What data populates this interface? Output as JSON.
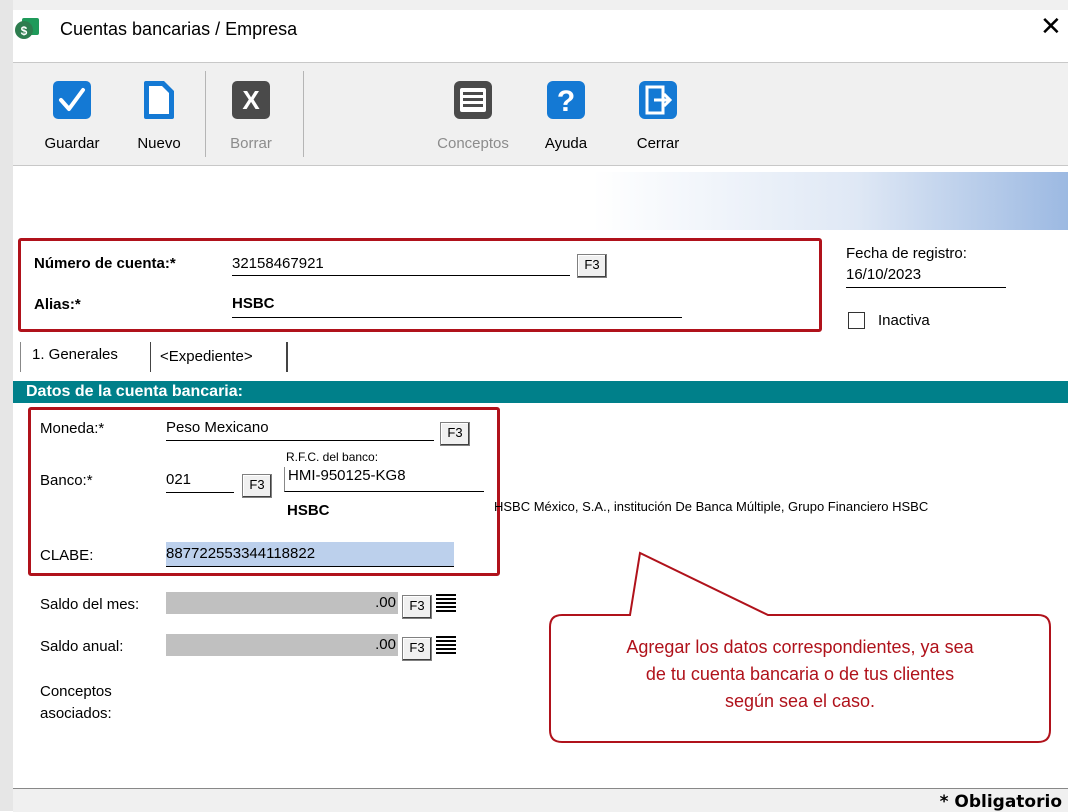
{
  "window": {
    "title": "Cuentas bancarias / Empresa",
    "close_glyph": "✕",
    "app_icon": "app-money-icon"
  },
  "toolbar": {
    "buttons": [
      {
        "id": "guardar",
        "label": "Guardar",
        "icon": "check-icon",
        "enabled": true
      },
      {
        "id": "nuevo",
        "label": "Nuevo",
        "icon": "new-document-icon",
        "enabled": true
      },
      {
        "id": "borrar",
        "label": "Borrar",
        "icon": "delete-x-icon",
        "enabled": false
      },
      {
        "id": "conceptos",
        "label": "Conceptos",
        "icon": "list-icon",
        "enabled": false
      },
      {
        "id": "ayuda",
        "label": "Ayuda",
        "icon": "help-icon",
        "enabled": true
      },
      {
        "id": "cerrar",
        "label": "Cerrar",
        "icon": "exit-door-icon",
        "enabled": true
      }
    ]
  },
  "header": {
    "numero_cuenta_label": "Número de cuenta:*",
    "numero_cuenta_value": "32158467921",
    "alias_label": "Alias:*",
    "alias_value": "HSBC",
    "f3": "F3",
    "fecha_label": "Fecha de registro:",
    "fecha_value": "16/10/2023",
    "inactiva_label": "Inactiva",
    "inactiva_checked": false
  },
  "tabs": [
    {
      "label": "1. Generales",
      "active": true
    },
    {
      "label": "<Expediente>",
      "active": false
    }
  ],
  "section": {
    "title": "Datos de la cuenta bancaria:"
  },
  "form": {
    "moneda_label": "Moneda:*",
    "moneda_value": "Peso Mexicano",
    "banco_label": "Banco:*",
    "banco_value": "021",
    "rfc_label": "R.F.C. del banco:",
    "rfc_value": "HMI-950125-KG8",
    "banco_nombre": "HSBC",
    "banco_razon_social": "HSBC México, S.A., institución De Banca Múltiple, Grupo Financiero HSBC",
    "clabe_label": "CLABE:",
    "clabe_value": "887722553344118822",
    "saldo_mes_label": "Saldo del mes:",
    "saldo_mes_value": ".00",
    "saldo_anual_label": "Saldo anual:",
    "saldo_anual_value": ".00",
    "conceptos_label_1": "Conceptos",
    "conceptos_label_2": "asociados:",
    "f3": "F3"
  },
  "callout": {
    "line1": "Agregar los datos correspondientes, ya sea",
    "line2": "de tu cuenta bancaria o de tus clientes",
    "line3": "según sea el caso.",
    "color": "#b0121b"
  },
  "footer": {
    "obligatorio": "* Obligatorio"
  },
  "colors": {
    "section_header": "#00808a",
    "highlight_box": "#b0121b",
    "icon_blue": "#1479d4"
  }
}
